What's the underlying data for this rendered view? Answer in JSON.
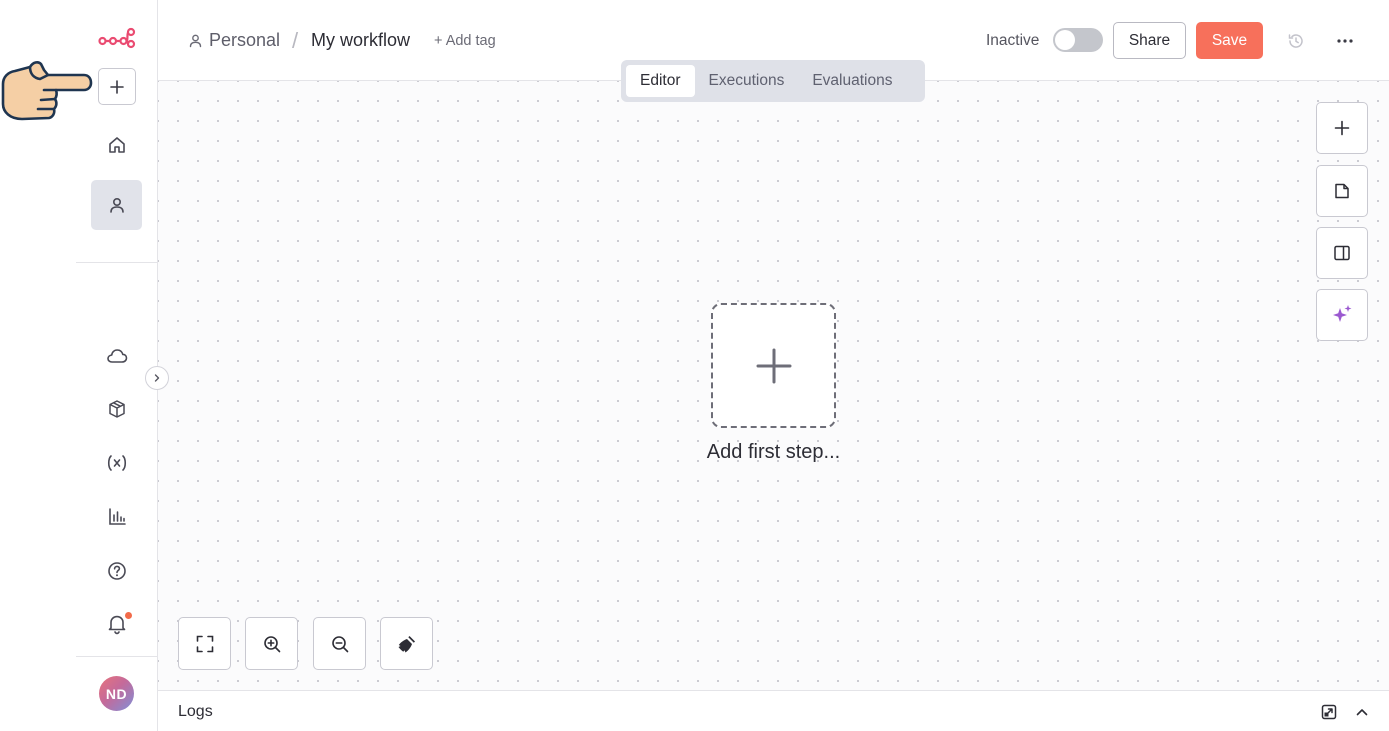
{
  "header": {
    "breadcrumb_project": "Personal",
    "breadcrumb_separator": "/",
    "workflow_title": "My workflow",
    "add_tag_label": "+ Add tag",
    "status_label": "Inactive",
    "active": false,
    "share_label": "Share",
    "save_label": "Save"
  },
  "tabs": [
    {
      "label": "Editor",
      "active": true
    },
    {
      "label": "Executions",
      "active": false
    },
    {
      "label": "Evaluations",
      "active": false
    }
  ],
  "canvas": {
    "add_first_step_label": "Add first step..."
  },
  "sidebar": {
    "avatar_initials": "ND",
    "notification_dot": true,
    "items": [
      "add",
      "home",
      "personal",
      "cloud",
      "templates",
      "variables",
      "insights",
      "help",
      "notifications"
    ]
  },
  "logs": {
    "label": "Logs"
  },
  "colors": {
    "accent": "#f7705b",
    "logo": "#ea4b71",
    "ai_sparkle": "#9b59d0",
    "active_nav_bg": "#e1e3ea"
  }
}
